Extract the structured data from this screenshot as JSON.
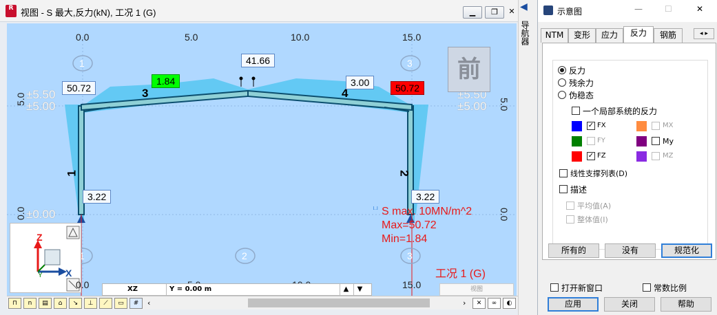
{
  "view": {
    "window_title": "视图 - S 最大,反力(kN), 工况 1 (G)",
    "app_logo": "R",
    "side_label": "导航器",
    "ruler_top": [
      "0.0",
      "5.0",
      "10.0",
      "15.0"
    ],
    "ruler_bottom": [
      "0.0",
      "5.0",
      "10.0",
      "15.0"
    ],
    "ruler_left": [
      "5.0",
      "0.0"
    ],
    "ruler_right": [
      "5.0",
      "0.0"
    ],
    "level_labels": [
      "±5.50",
      "±5.00",
      "±0.00"
    ],
    "level_labels_right": [
      "±5.50",
      "±5.00"
    ],
    "support_nodes": [
      "1",
      "3",
      "2",
      "1",
      "3"
    ],
    "member_labels": [
      "1",
      "2",
      "3",
      "4"
    ],
    "value_boxes": {
      "top_left": "50.72",
      "top_min": "1.84",
      "top_apex": "41.66",
      "top_right_member": "3.00",
      "top_right_max": "50.72",
      "base_left": "3.22",
      "base_right": "3.22"
    },
    "view_cube_label": "前",
    "legend": {
      "line1": "S max. 10MN/m^2",
      "line2": "Max=50.72",
      "line3": "Min=1.84"
    },
    "load_case": "工况 1 (G)",
    "axes": {
      "z": "Z",
      "x": "X",
      "y": "Y"
    },
    "status": {
      "plane": "XZ",
      "coord": "Y = 0.00 m",
      "view": "视图"
    },
    "colors": {
      "max_box": "#ff0000",
      "min_box": "#00ff00",
      "stress_fill": "#56c7f2",
      "legend_text": "#e81919"
    }
  },
  "panel": {
    "title": "示意图",
    "tabs": [
      "NTM",
      "变形",
      "应力",
      "反力",
      "钢筋"
    ],
    "active_tab": "反力",
    "radios": [
      {
        "label": "反力",
        "checked": true
      },
      {
        "label": "残余力",
        "checked": false
      },
      {
        "label": "伪稳态",
        "checked": false
      }
    ],
    "local_reaction": "一个局部系统的反力",
    "components": [
      {
        "label": "FX",
        "color": "#0000ff",
        "checked": true,
        "enabled": true
      },
      {
        "label": "MX",
        "color": "#ff8c40",
        "checked": false,
        "enabled": false
      },
      {
        "label": "FY",
        "color": "#008000",
        "checked": false,
        "enabled": false
      },
      {
        "label": "My",
        "color": "#800080",
        "checked": false,
        "enabled": true
      },
      {
        "label": "FZ",
        "color": "#ff0000",
        "checked": true,
        "enabled": true
      },
      {
        "label": "MZ",
        "color": "#8a2be2",
        "checked": false,
        "enabled": false
      }
    ],
    "linear_support": "线性支撑列表(D)",
    "describe": "描述",
    "sub_options": [
      "平均值(A)",
      "整体值(I)"
    ],
    "buttons": {
      "all": "所有的",
      "none": "没有",
      "normalize": "规范化"
    },
    "open_new_window": "打开新窗口",
    "constant_scale": "常数比例",
    "apply": "应用",
    "close": "关闭",
    "help": "帮助"
  }
}
